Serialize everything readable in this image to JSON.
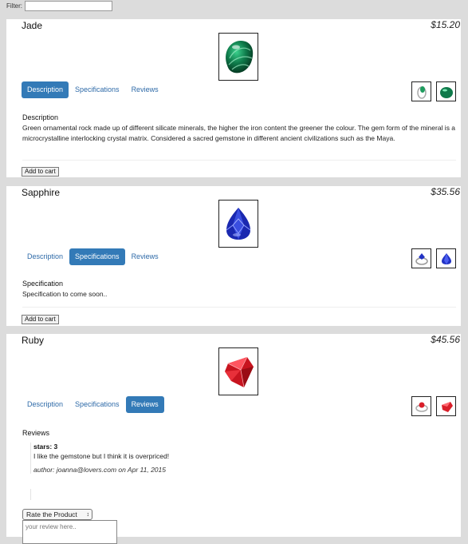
{
  "filter": {
    "label": "Filter:",
    "value": ""
  },
  "products": [
    {
      "name": "Jade",
      "price": "$15.20",
      "tabs": [
        "Description",
        "Specifications",
        "Reviews"
      ],
      "active_tab": "Description",
      "panel_title": "Description",
      "panel_text": "Green ornamental rock made up of different silicate minerals, the higher the iron content the greener the colour. The gem form of the mineral is a microcrystalline interlocking crystal matrix. Considered a sacred gemstone in different ancient civilizations such as the Maya.",
      "button": "Add to cart",
      "colors": {
        "main": "#0e7a4a",
        "light": "#32b879",
        "dark": "#05331f"
      }
    },
    {
      "name": "Sapphire",
      "price": "$35.56",
      "tabs": [
        "Description",
        "Specifications",
        "Reviews"
      ],
      "active_tab": "Specifications",
      "panel_title": "Specification",
      "panel_text": "Specification to come soon..",
      "button": "Add to cart",
      "colors": {
        "main": "#2233c4",
        "light": "#7d8cff",
        "dark": "#0b1266"
      }
    },
    {
      "name": "Ruby",
      "price": "$45.56",
      "tabs": [
        "Description",
        "Specifications",
        "Reviews"
      ],
      "active_tab": "Reviews",
      "panel_title": "Reviews",
      "review": {
        "stars": "stars: 3",
        "body": "I like the gemstone but I think it is overpriced!",
        "author": "author: joanna@lovers.com on Apr 11, 2015"
      },
      "rate_select": "Rate the Product",
      "review_placeholder": "your review here..",
      "colors": {
        "main": "#d91f2a",
        "light": "#ff8080",
        "dark": "#7a0a10"
      }
    }
  ],
  "accent": "#337ab7"
}
